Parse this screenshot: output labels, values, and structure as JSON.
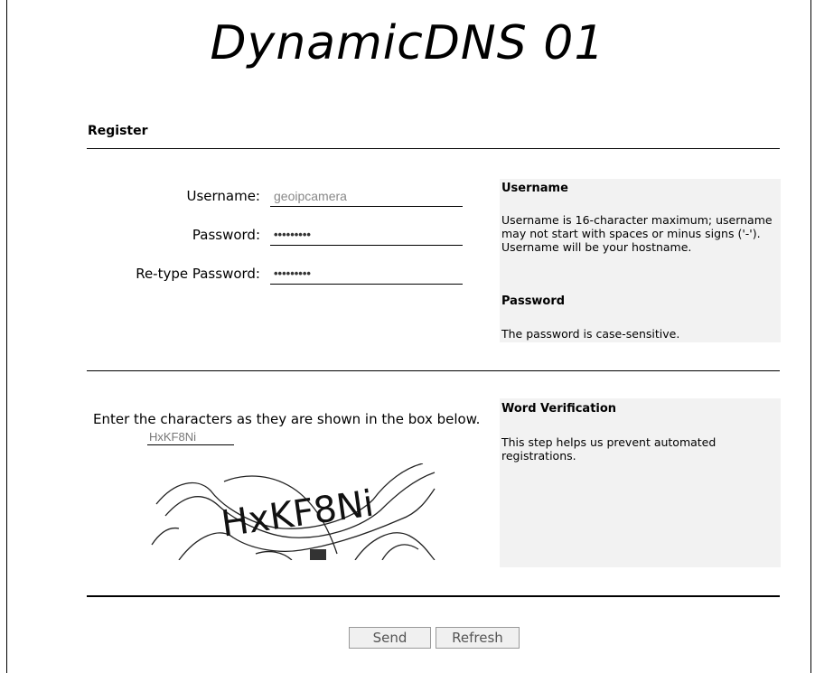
{
  "page_title": "DynamicDNS 01",
  "register_heading": "Register",
  "form": {
    "username_label": "Username:",
    "username_value": "geoipcamera",
    "password_label": "Password:",
    "password_value": "•••••••••",
    "retype_label": "Re-type Password:",
    "retype_value": "•••••••••"
  },
  "help": {
    "username_title": "Username",
    "username_text": "Username is 16-character maximum; username may not start with spaces or minus signs ('-'). Username will be your hostname.",
    "password_title": "Password",
    "password_text": "The password is case-sensitive."
  },
  "verification": {
    "instruction_text": "Enter the characters as they are shown in the box below.",
    "input_value": "HxKF8Ni",
    "captcha_text": "HxKF8Ni",
    "help_title": "Word Verification",
    "help_text": "This step helps us prevent automated registrations."
  },
  "buttons": {
    "send_label": "Send",
    "refresh_label": "Refresh"
  }
}
